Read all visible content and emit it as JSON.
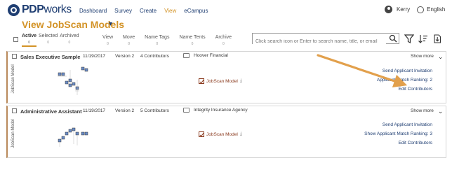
{
  "header": {
    "logo_bold": "PDP",
    "logo_thin": "works",
    "nav": [
      "Dashboard",
      "Survey",
      "Create",
      "View",
      "eCampus"
    ],
    "active_nav": "View",
    "user_name": "Kerry",
    "language": "English"
  },
  "page": {
    "title": "View JobScan Models",
    "caret": "▾"
  },
  "filters": {
    "tabs": [
      {
        "label": "Active",
        "count": "0"
      },
      {
        "label": "Selected",
        "count": "0"
      },
      {
        "label": "Archived",
        "count": "0"
      }
    ],
    "columns": [
      {
        "label": "View",
        "count": "0"
      },
      {
        "label": "Move",
        "count": "0"
      },
      {
        "label": "Name Tags",
        "count": "0"
      },
      {
        "label": "Name Tents",
        "count": "0"
      },
      {
        "label": "Archive",
        "count": "0"
      }
    ],
    "search_placeholder": "Click search icon or Enter to search name, title, or email"
  },
  "cards": [
    {
      "side_label": "JobScan Model",
      "name": "Sales Executive Sample",
      "date": "11/19/2017",
      "version": "Version 2",
      "contributors": "4 Contributors",
      "folder": "Hoover Financial",
      "show_more": "Show more",
      "model_tag": "JobScan Model",
      "links": [
        "Send Applicant Invitation",
        "Applicant Match Ranking: 2",
        "Edit Contributors"
      ]
    },
    {
      "side_label": "JobScan Model",
      "name": "Administrative Assistant",
      "date": "11/19/2017",
      "version": "Version 2",
      "contributors": "5 Contributors",
      "folder": "Integrity Insurance Agency",
      "show_more": "Show more",
      "model_tag": "JobScan Model",
      "links": [
        "Send Applicant Invitation",
        "Show Applicant Match Ranking: 3",
        "Edit Contributors"
      ]
    }
  ],
  "colors": {
    "brand": "#1f3e72",
    "accent": "#d39327",
    "model": "#8a3a1e",
    "arrow": "#e2a04c"
  }
}
